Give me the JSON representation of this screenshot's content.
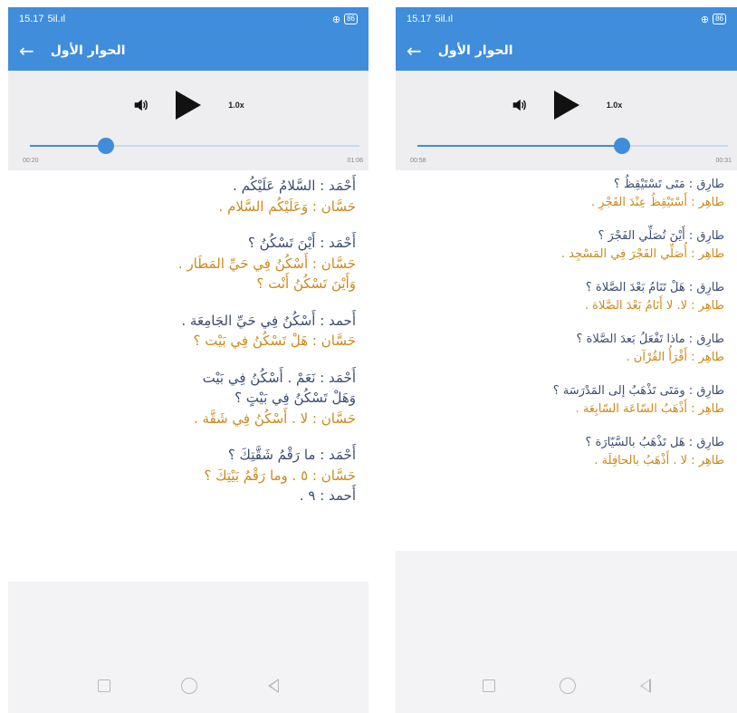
{
  "screens": [
    {
      "status": {
        "time": "15.17",
        "signal": "5il.ıl",
        "icons": "⊕",
        "battery": "86"
      },
      "appbar": {
        "title": "الحوار الأول"
      },
      "player": {
        "speed": "1.0x",
        "elapsed": "00:20",
        "total": "01:06",
        "progress": 0.23
      },
      "dialogues": [
        {
          "lines": [
            {
              "speaker": 1,
              "text": "أَحْمَد : السَّلامُ عَلَيْكُم ."
            },
            {
              "speaker": 2,
              "text": "حَسَّان : وَعَلَيْكُم السَّلام ."
            }
          ]
        },
        {
          "lines": [
            {
              "speaker": 1,
              "text": "أَحْمَد : أَيْنَ تَسْكُنُ ؟"
            },
            {
              "speaker": 2,
              "text": "حَسَّان : أَسْكُنُ فِي حَيِّ المَطَار ."
            },
            {
              "speaker": 2,
              "text": "وَأَيْنَ تَسْكُنُ أَنْت ؟"
            }
          ]
        },
        {
          "lines": [
            {
              "speaker": 1,
              "text": "أَحمد : أَسْكُنُ فِي حَيِّ الجَامِعَة ."
            },
            {
              "speaker": 2,
              "text": "حَسَّان : هَلْ تَسْكُنُ فِي بَيْت ؟"
            }
          ]
        },
        {
          "lines": [
            {
              "speaker": 1,
              "text": "أَحْمَد : نَعَمْ . أَسْكُنُ فِي بَيْت"
            },
            {
              "speaker": 1,
              "text": "وَهَلْ تَسْكُنُ فِي بَيْتٍ ؟"
            },
            {
              "speaker": 2,
              "text": "حَسَّان : لا . أَسْكُنُ فِي شَقَّة ."
            }
          ]
        },
        {
          "lines": [
            {
              "speaker": 1,
              "text": "أَحْمَد : ما رَقْمُ شَقَّتِكَ ؟"
            },
            {
              "speaker": 2,
              "text": "حَسَّان : ٥ . وما رَقْمُ بَيْتِكَ ؟"
            },
            {
              "speaker": 1,
              "text": "أَحمد : ٩ ."
            }
          ]
        }
      ]
    },
    {
      "status": {
        "time": "15.17",
        "signal": "5il.ıl",
        "icons": "⊕",
        "battery": "86"
      },
      "appbar": {
        "title": "الحوار الأول"
      },
      "player": {
        "speed": "1.0x",
        "elapsed": "00:58",
        "total": "00:31",
        "progress": 0.66
      },
      "dialogues": [
        {
          "lines": [
            {
              "speaker": 1,
              "text": "طارِق : مَتَى تَسْتَيْقِظُ ؟"
            },
            {
              "speaker": 2,
              "text": "طاهِر : أَسْتَيْقِظُ عِنْدَ الفَجْرِ ."
            }
          ]
        },
        {
          "lines": [
            {
              "speaker": 1,
              "text": "طارِق : أَيْنَ تُصَلِّي الفَجْرَ ؟"
            },
            {
              "speaker": 2,
              "text": "طاهِر : أُصَلِّي الفَجْرَ فِي المَسْجِد ."
            }
          ]
        },
        {
          "lines": [
            {
              "speaker": 1,
              "text": "طارِق : هَلْ تَنَامُ بَعْدَ الصَّلاة ؟"
            },
            {
              "speaker": 2,
              "text": "طاهِر : لا. لا أَنَامُ بَعْدَ الصَّلاة ."
            }
          ]
        },
        {
          "lines": [
            {
              "speaker": 1,
              "text": "طارِق : ماذا تَفْعَلُ بَعدَ الصَّلاة ؟"
            },
            {
              "speaker": 2,
              "text": "طاهِر : أَقْرَأُ القُرْآن ."
            }
          ]
        },
        {
          "lines": [
            {
              "speaker": 1,
              "text": "طارِق : ومَتَى تَذْهَبُ إلى المَدْرَسَة ؟"
            },
            {
              "speaker": 2,
              "text": "طاهِر : أَذْهَبُ السّاعَة السّابِعَة ."
            }
          ]
        },
        {
          "lines": [
            {
              "speaker": 1,
              "text": "طارِق : هَل تَذْهَبُ بالسَّيّارَة ؟"
            },
            {
              "speaker": 2,
              "text": "طاهِر : لا . أَذْهَبُ بالحافِلَة ."
            }
          ]
        }
      ]
    }
  ],
  "colors": {
    "primary": "#3f8ddb",
    "speaker1": "#3a4c72",
    "speaker2": "#c98a1c",
    "background": "#f3f3f5"
  },
  "icons": {
    "back": "arrow-left-icon",
    "volume": "speaker-icon",
    "play": "play-icon",
    "nav": [
      "square-icon",
      "circle-icon",
      "triangle-back-icon"
    ]
  }
}
